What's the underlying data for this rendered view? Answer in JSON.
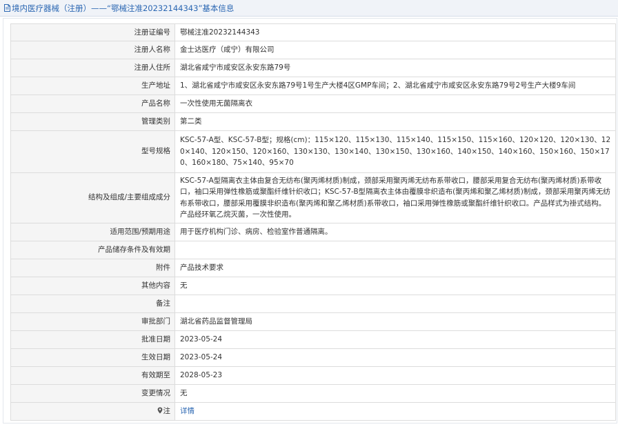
{
  "header": {
    "icon": "document-icon",
    "title": "境内医疗器械（注册）——“鄂械注准20232144343”基本信息"
  },
  "rows": [
    {
      "label": "注册证编号",
      "value": "鄂械注准20232144343"
    },
    {
      "label": "注册人名称",
      "value": "金士达医疗（咸宁）有限公司"
    },
    {
      "label": "注册人住所",
      "value": "湖北省咸宁市咸安区永安东路79号"
    },
    {
      "label": "生产地址",
      "value": "1、湖北省咸宁市咸安区永安东路79号1号生产大楼4区GMP车间；2、湖北省咸宁市咸安区永安东路79号2号生产大楼9车间"
    },
    {
      "label": "产品名称",
      "value": "一次性使用无菌隔离衣"
    },
    {
      "label": "管理类别",
      "value": "第二类"
    },
    {
      "label": "型号规格",
      "value": "KSC-57-A型、KSC-57-B型；规格(cm)：115×120、115×130、115×140、115×150、115×160、120×120、120×130、120×140、120×150、120×160、130×130、130×140、130×150、130×160、140×150、140×160、150×160、150×170、160×180、75×140、95×70"
    },
    {
      "label": "结构及组成/主要组成成分",
      "value": "KSC-57-A型隔离衣主体由复合无纺布(聚丙烯材质)制成，颈部采用聚丙烯无纺布系带收口，腰部采用复合无纺布(聚丙烯材质)系带收口，袖口采用弹性橡筋或聚酯纤维针织收口；KSC-57-B型隔离衣主体由覆膜非织造布(聚丙烯和聚乙烯材质)制成，颈部采用聚丙烯无纺布系带收口，腰部采用覆膜非织造布(聚丙烯和聚乙烯材质)系带收口，袖口采用弹性橡筋或聚酯纤维针织收口。产品样式为褂式结构。产品经环氧乙烷灭菌，一次性使用。"
    },
    {
      "label": "适用范围/预期用途",
      "value": "用于医疗机构门诊、病房、检验室作普通隔离。"
    },
    {
      "label": "产品储存条件及有效期",
      "value": ""
    },
    {
      "label": "附件",
      "value": "产品技术要求"
    },
    {
      "label": "其他内容",
      "value": "无"
    },
    {
      "label": "备注",
      "value": ""
    },
    {
      "label": "审批部门",
      "value": "湖北省药品监督管理局"
    },
    {
      "label": "批准日期",
      "value": "2023-05-24"
    },
    {
      "label": "生效日期",
      "value": "2023-05-24"
    },
    {
      "label": "有效期至",
      "value": "2028-05-23"
    },
    {
      "label": "变更情况",
      "value": "无"
    }
  ],
  "note": {
    "icon": "pin-icon",
    "label": "注",
    "link_text": "详情"
  },
  "colors": {
    "accent": "#2a66b2",
    "label_bg": "#f5f5f5",
    "header_bg": "#f0f3f8",
    "border": "#dcdcdc"
  }
}
